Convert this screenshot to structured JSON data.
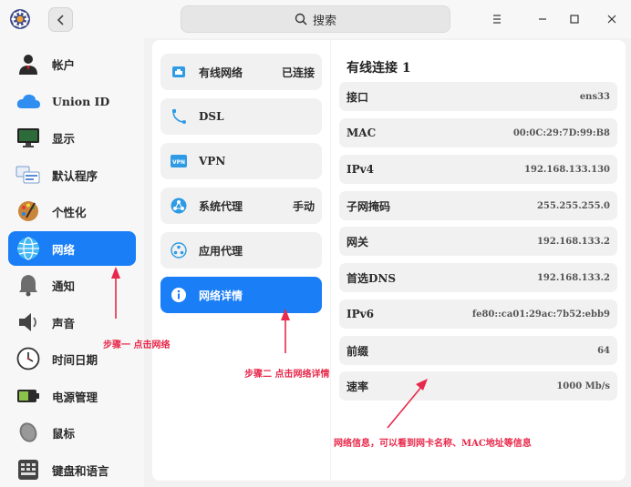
{
  "search": {
    "placeholder": "搜索"
  },
  "sidebar": {
    "items": [
      {
        "label": "帐户",
        "icon": "user-icon"
      },
      {
        "label": "Union  ID",
        "icon": "cloud-icon"
      },
      {
        "label": "显示",
        "icon": "monitor-icon"
      },
      {
        "label": "默认程序",
        "icon": "default-apps-icon"
      },
      {
        "label": "个性化",
        "icon": "palette-icon"
      },
      {
        "label": "网络",
        "icon": "network-icon"
      },
      {
        "label": "通知",
        "icon": "bell-icon"
      },
      {
        "label": "声音",
        "icon": "speaker-icon"
      },
      {
        "label": "时间日期",
        "icon": "clock-icon"
      },
      {
        "label": "电源管理",
        "icon": "battery-icon"
      },
      {
        "label": "鼠标",
        "icon": "mouse-icon"
      },
      {
        "label": "键盘和语言",
        "icon": "keyboard-icon"
      }
    ],
    "active_index": 5
  },
  "network": {
    "items": [
      {
        "label": "有线网络",
        "status": "已连接",
        "icon": "wired-network-icon"
      },
      {
        "label": "DSL",
        "status": "",
        "icon": "dsl-icon"
      },
      {
        "label": "VPN",
        "status": "",
        "icon": "vpn-icon",
        "icon_text": "VPN"
      },
      {
        "label": "系统代理",
        "status": "手动",
        "icon": "system-proxy-icon"
      },
      {
        "label": "应用代理",
        "status": "",
        "icon": "app-proxy-icon"
      },
      {
        "label": "网络详情",
        "status": "",
        "icon": "info-icon"
      }
    ],
    "active_index": 5
  },
  "details": {
    "title": "有线连接 1",
    "rows": [
      {
        "key": "接口",
        "value": "ens33"
      },
      {
        "key": "MAC",
        "value": "00:0C:29:7D:99:B8"
      },
      {
        "key": "IPv4",
        "value": "192.168.133.130"
      },
      {
        "key": "子网掩码",
        "value": "255.255.255.0"
      },
      {
        "key": "网关",
        "value": "192.168.133.2"
      },
      {
        "key": "首选DNS",
        "value": "192.168.133.2"
      },
      {
        "key": "IPv6",
        "value": "fe80::ca01:29ac:7b52:ebb9"
      },
      {
        "key": "前缀",
        "value": "64"
      },
      {
        "key": "速率",
        "value": "1000  Mb/s"
      }
    ]
  },
  "annotations": {
    "step1": "步骤一 点击网络",
    "step2": "步骤二 点击网络详情",
    "step3": "网络信息，可以看到网卡名称、MAC地址等信息"
  },
  "colors": {
    "accent": "#1a7ef6",
    "annotation": "#e8294b"
  }
}
